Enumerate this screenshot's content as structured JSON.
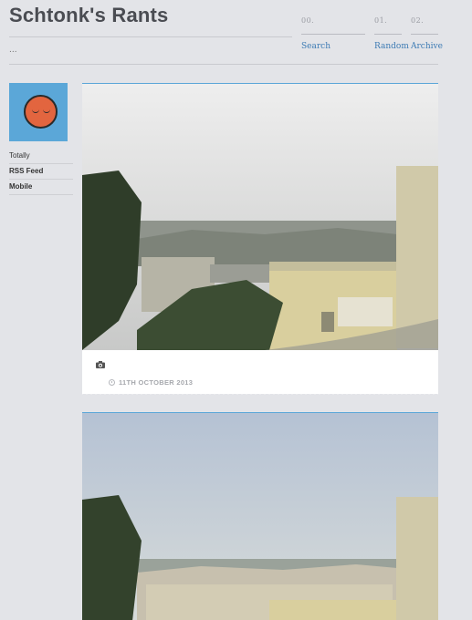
{
  "site": {
    "title": "Schtonk's Rants",
    "subtitle": "..."
  },
  "nav": [
    {
      "num": "00.",
      "label": "Search"
    },
    {
      "num": "01.",
      "label": "Random"
    },
    {
      "num": "02.",
      "label": "Archive"
    }
  ],
  "sidebar": {
    "links": [
      "Totally",
      "RSS Feed",
      "Mobile"
    ]
  },
  "posts": [
    {
      "type": "photo",
      "date": "11TH OCTOBER 2013",
      "icon": "camera-icon"
    },
    {
      "type": "photo"
    }
  ],
  "colors": {
    "background": "#e3e4e8",
    "accent": "#5ba7d8",
    "link": "#3d7bb4",
    "avatar_face": "#e2653f"
  }
}
